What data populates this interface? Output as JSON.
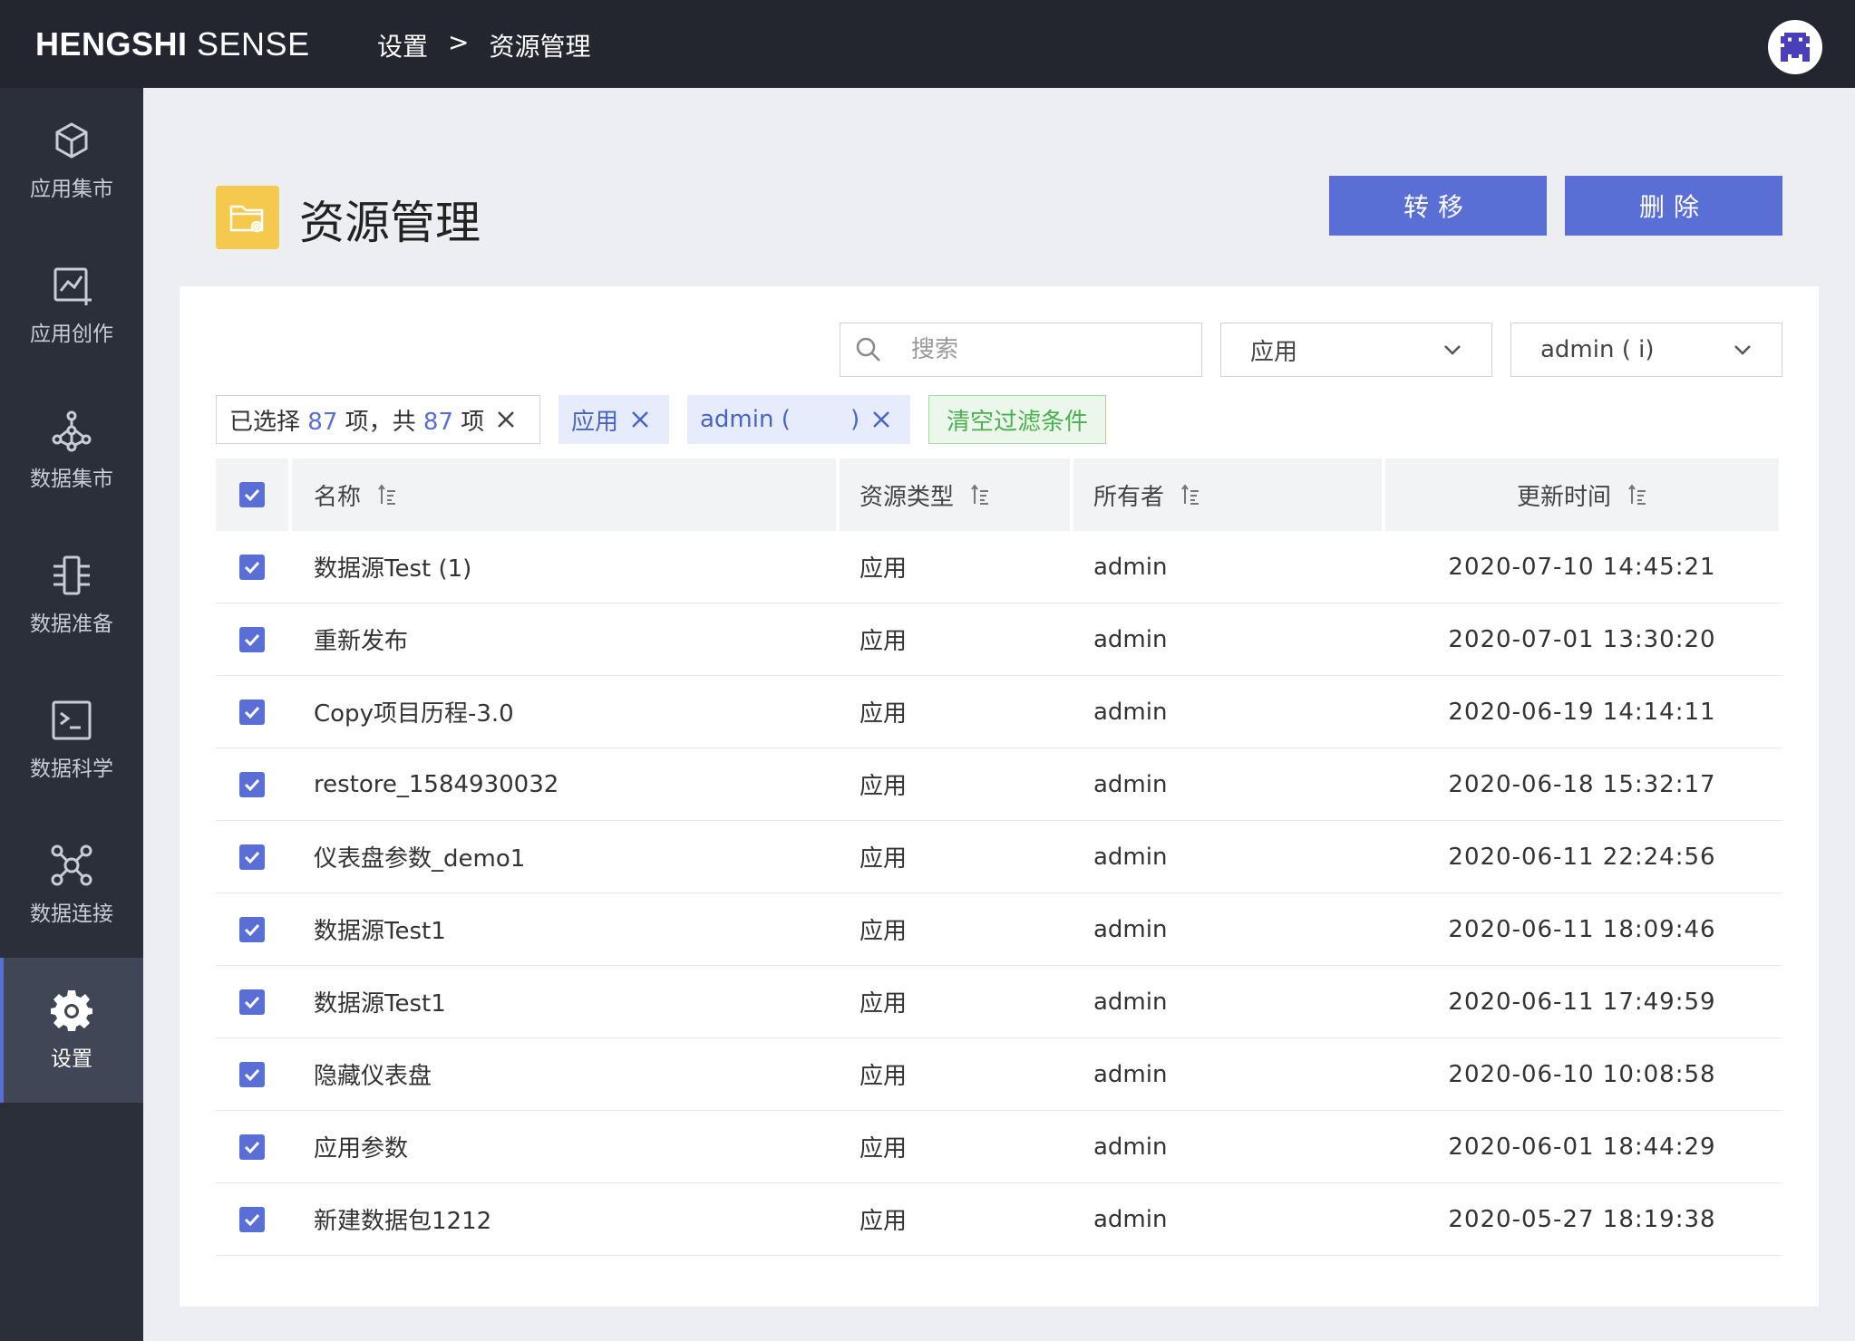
{
  "topbar": {
    "logo_bold": "HENGSHI",
    "logo_light": " SENSE",
    "breadcrumb": [
      "设置",
      ">",
      "资源管理"
    ]
  },
  "sidebar": {
    "items": [
      {
        "label": "应用集市",
        "icon": "cube-icon"
      },
      {
        "label": "应用创作",
        "icon": "chart-add-icon"
      },
      {
        "label": "数据集市",
        "icon": "molecule-icon"
      },
      {
        "label": "数据准备",
        "icon": "flow-icon"
      },
      {
        "label": "数据科学",
        "icon": "terminal-icon"
      },
      {
        "label": "数据连接",
        "icon": "network-icon"
      },
      {
        "label": "设置",
        "icon": "gear-icon",
        "active": true
      }
    ]
  },
  "page": {
    "title": "资源管理",
    "transfer_label": "转移",
    "delete_label": "删除"
  },
  "filters": {
    "search_placeholder": "搜索",
    "type_select": "应用",
    "owner_select": "admin (     i)",
    "selected_prefix": "已选择",
    "selected_count": "87",
    "selected_mid": "项，共",
    "total_count": "87",
    "selected_suffix": "项",
    "tag_type": "应用",
    "tag_owner": "admin (        )",
    "clear_label": "清空过滤条件"
  },
  "table": {
    "columns": [
      "名称",
      "资源类型",
      "所有者",
      "更新时间"
    ],
    "rows": [
      {
        "name": "数据源Test (1)",
        "type": "应用",
        "owner": "admin",
        "time": "2020-07-10 14:45:21"
      },
      {
        "name": "重新发布",
        "type": "应用",
        "owner": "admin",
        "time": "2020-07-01 13:30:20"
      },
      {
        "name": "Copy项目历程-3.0",
        "type": "应用",
        "owner": "admin",
        "time": "2020-06-19 14:14:11"
      },
      {
        "name": "restore_1584930032",
        "type": "应用",
        "owner": "admin",
        "time": "2020-06-18 15:32:17"
      },
      {
        "name": "仪表盘参数_demo1",
        "type": "应用",
        "owner": "admin",
        "time": "2020-06-11 22:24:56"
      },
      {
        "name": "数据源Test1",
        "type": "应用",
        "owner": "admin",
        "time": "2020-06-11 18:09:46"
      },
      {
        "name": "数据源Test1",
        "type": "应用",
        "owner": "admin",
        "time": "2020-06-11 17:49:59"
      },
      {
        "name": "隐藏仪表盘",
        "type": "应用",
        "owner": "admin",
        "time": "2020-06-10 10:08:58"
      },
      {
        "name": "应用参数",
        "type": "应用",
        "owner": "admin",
        "time": "2020-06-01 18:44:29"
      },
      {
        "name": "新建数据包1212",
        "type": "应用",
        "owner": "admin",
        "time": "2020-05-27 18:19:38"
      }
    ]
  },
  "colors": {
    "accent": "#5a6fd6",
    "topbar": "#23262f",
    "sidebar": "#2b2f3a",
    "folder": "#f5c94e"
  }
}
